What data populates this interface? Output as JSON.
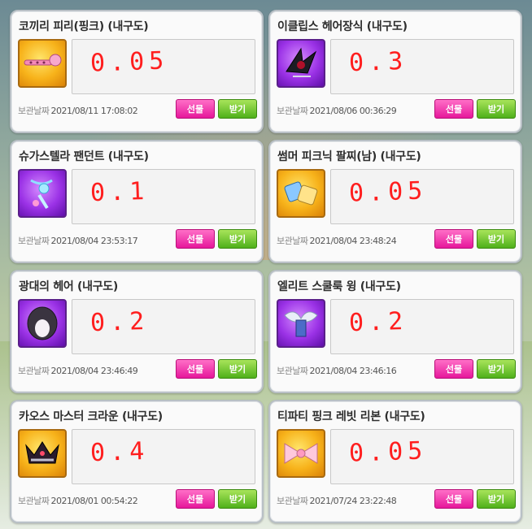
{
  "items": [
    {
      "title": "코끼리 피리(핑크) (내구도)",
      "note": "0.05",
      "date_label": "보관날짜",
      "date": "2021/08/11 17:08:02",
      "gift_label": "선물",
      "get_label": "받기",
      "icon": "pink-flute-icon",
      "bg": "orange"
    },
    {
      "title": "이클립스 헤어장식 (내구도)",
      "note": "0.3",
      "date_label": "보관날짜",
      "date": "2021/08/06 00:36:29",
      "gift_label": "선물",
      "get_label": "받기",
      "icon": "eclipse-hair-ornament-icon",
      "bg": "purple"
    },
    {
      "title": "슈가스텔라 팬던트 (내구도)",
      "note": "0.1",
      "date_label": "보관날짜",
      "date": "2021/08/04 23:53:17",
      "gift_label": "선물",
      "get_label": "받기",
      "icon": "sugar-stella-pendant-icon",
      "bg": "purple"
    },
    {
      "title": "썸머 피크닉 팔찌(남) (내구도)",
      "note": "0.05",
      "date_label": "보관날짜",
      "date": "2021/08/04 23:48:24",
      "gift_label": "선물",
      "get_label": "받기",
      "icon": "summer-picnic-bracelet-icon",
      "bg": "orange"
    },
    {
      "title": "광대의 헤어 (내구도)",
      "note": "0.2",
      "date_label": "보관날짜",
      "date": "2021/08/04 23:46:49",
      "gift_label": "선물",
      "get_label": "받기",
      "icon": "clown-hair-icon",
      "bg": "purple"
    },
    {
      "title": "엘리트 스쿨룩 윙 (내구도)",
      "note": "0.2",
      "date_label": "보관날짜",
      "date": "2021/08/04 23:46:16",
      "gift_label": "선물",
      "get_label": "받기",
      "icon": "elite-school-wing-icon",
      "bg": "purple"
    },
    {
      "title": "카오스 마스터 크라운 (내구도)",
      "note": "0.4",
      "date_label": "보관날짜",
      "date": "2021/08/01 00:54:22",
      "gift_label": "선물",
      "get_label": "받기",
      "icon": "chaos-master-crown-icon",
      "bg": "orange"
    },
    {
      "title": "티파티 핑크 레빗 리본 (내구도)",
      "note": "0.05",
      "date_label": "보관날짜",
      "date": "2021/07/24 23:22:48",
      "gift_label": "선물",
      "get_label": "받기",
      "icon": "tea-party-ribbon-icon",
      "bg": "orange"
    }
  ]
}
